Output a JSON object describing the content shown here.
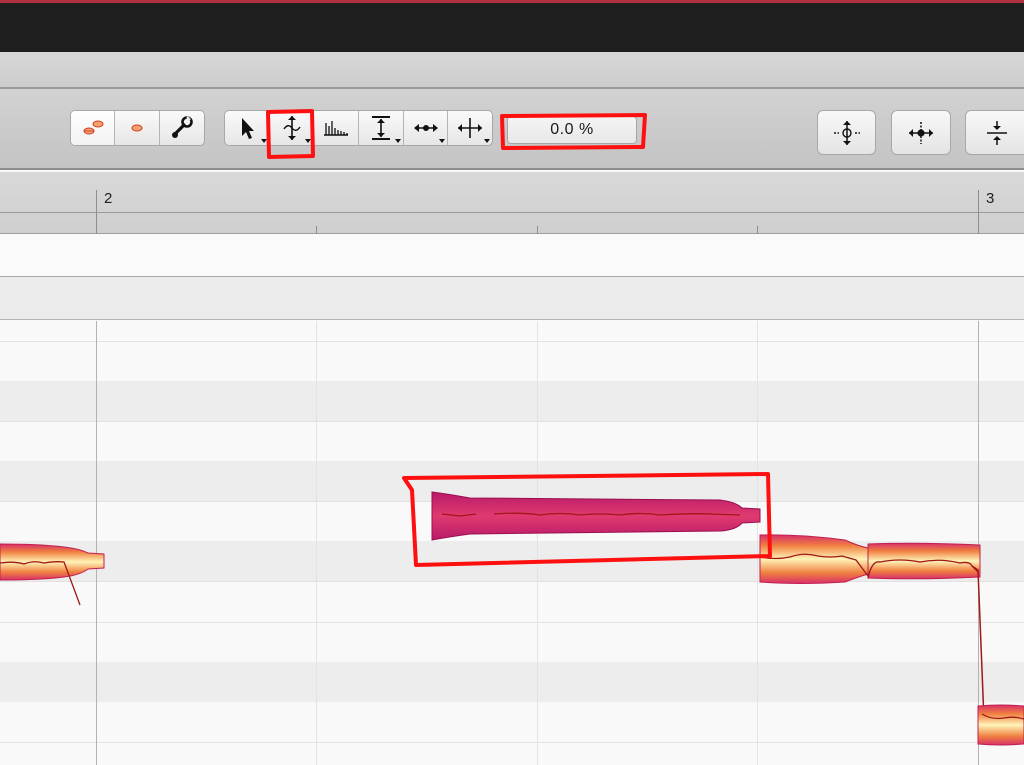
{
  "toolbar": {
    "mode_buttons": [
      {
        "icon": "blobs-note-icon",
        "active": true
      },
      {
        "icon": "single-blob-icon",
        "active": false
      },
      {
        "icon": "wrench-icon",
        "active": false
      }
    ],
    "tool_buttons": [
      {
        "icon": "arrow-pointer-icon",
        "has_menu": true
      },
      {
        "icon": "pitch-tool-icon",
        "has_menu": true,
        "highlighted": true
      },
      {
        "icon": "formant-tool-icon",
        "has_menu": false
      },
      {
        "icon": "amplitude-tool-icon",
        "has_menu": true
      },
      {
        "icon": "timing-tool-icon",
        "has_menu": true
      },
      {
        "icon": "separation-tool-icon",
        "has_menu": true
      }
    ],
    "value_field": "0.0 %",
    "right_buttons": [
      {
        "icon": "pitch-quantize-icon"
      },
      {
        "icon": "time-quantize-icon"
      },
      {
        "icon": "compress-icon"
      }
    ]
  },
  "ruler": {
    "bar_labels": [
      "2",
      "3"
    ]
  },
  "colors": {
    "annotation": "#ff0000",
    "selected_note": "#c0206a",
    "note_light": "#fff0b0",
    "note_mid": "#e8803a"
  }
}
